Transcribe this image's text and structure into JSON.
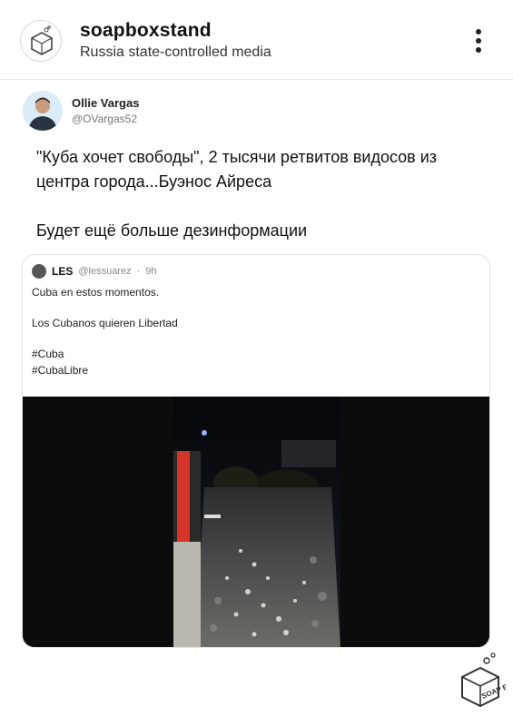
{
  "header": {
    "channel_name": "soapboxstand",
    "channel_subtitle": "Russia state-controlled media",
    "avatar_icon": "soapbox-logo-icon",
    "menu_icon": "more-vertical-icon"
  },
  "tweet": {
    "author_name": "Ollie Vargas",
    "author_handle": "@OVargas52",
    "text_line1": "\"Куба хочет свободы\", 2 тысячи ретвитов видосов из центра города...Буэнос Айреса",
    "text_line2": "Будет ещё больше дезинформации"
  },
  "quoted_tweet": {
    "author_name": "LES",
    "author_handle": "@lessuarez",
    "time": "9h",
    "meta_separator": "·",
    "lines": [
      "Cuba en estos momentos.",
      "Los Cubanos quieren Libertad",
      "#Cuba",
      "#CubaLibre"
    ],
    "media": "night-street-crowd-video"
  },
  "watermark": {
    "icon": "soapbox-logo-icon",
    "text": "SOAP BOX"
  },
  "colors": {
    "background": "#ffffff",
    "video_background": "#0c0c0c",
    "link_blue": "#1d9bf0"
  }
}
